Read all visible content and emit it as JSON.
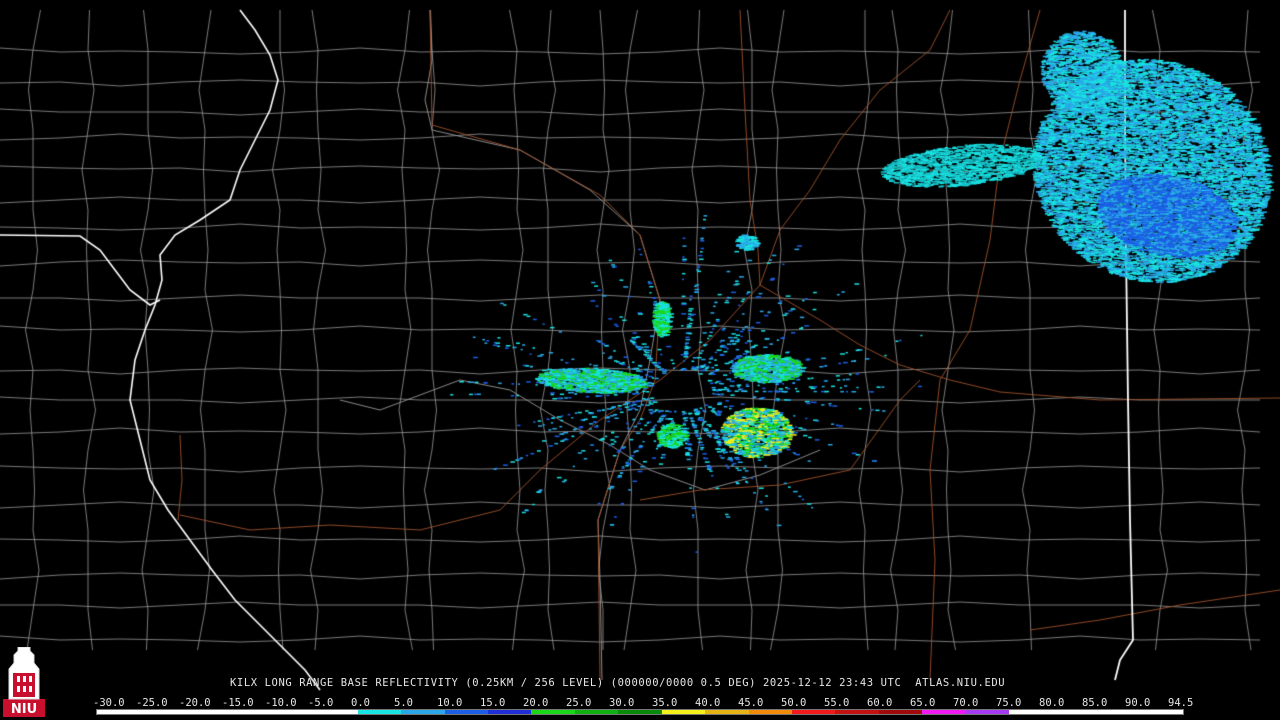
{
  "product_title": "KILX LONG RANGE BASE REFLECTIVITY (0.25KM / 256 LEVEL) (000000/0000 0.5 DEG) 2025-12-12 23:43 UTC  ATLAS.NIU.EDU",
  "logo": {
    "text": "NIU",
    "icon": "niu-logo-icon",
    "color": "#c8102e"
  },
  "scale": {
    "labels": [
      "-30.0",
      "-25.0",
      "-20.0",
      "-15.0",
      "-10.0",
      "-5.0",
      "0.0",
      "5.0",
      "10.0",
      "15.0",
      "20.0",
      "25.0",
      "30.0",
      "35.0",
      "40.0",
      "45.0",
      "50.0",
      "55.0",
      "60.0",
      "65.0",
      "70.0",
      "75.0",
      "80.0",
      "85.0",
      "90.0",
      "94.5"
    ],
    "colors": [
      "#ffffff",
      "#ffffff",
      "#ffffff",
      "#ffffff",
      "#ffffff",
      "#ffffff",
      "#19e3e3",
      "#2aa8e8",
      "#1c5fe6",
      "#1f2ed8",
      "#18d818",
      "#10b010",
      "#0a8a0a",
      "#f2f21a",
      "#e6b412",
      "#f28a0c",
      "#f21a1a",
      "#c41212",
      "#a00a0a",
      "#f21af2",
      "#a63af2",
      "#ffffff",
      "#ffffff",
      "#ffffff",
      "#ffffff"
    ]
  },
  "colors": {
    "county_lines": "#9a9a9a",
    "state_lines": "#ffffff",
    "highways": "#a0522d",
    "echo_light": "#19e3e3",
    "echo_mid": "#2aa8e8",
    "echo_deep": "#1c5fe6",
    "echo_green": "#18d818",
    "echo_yellow": "#f2f21a"
  }
}
